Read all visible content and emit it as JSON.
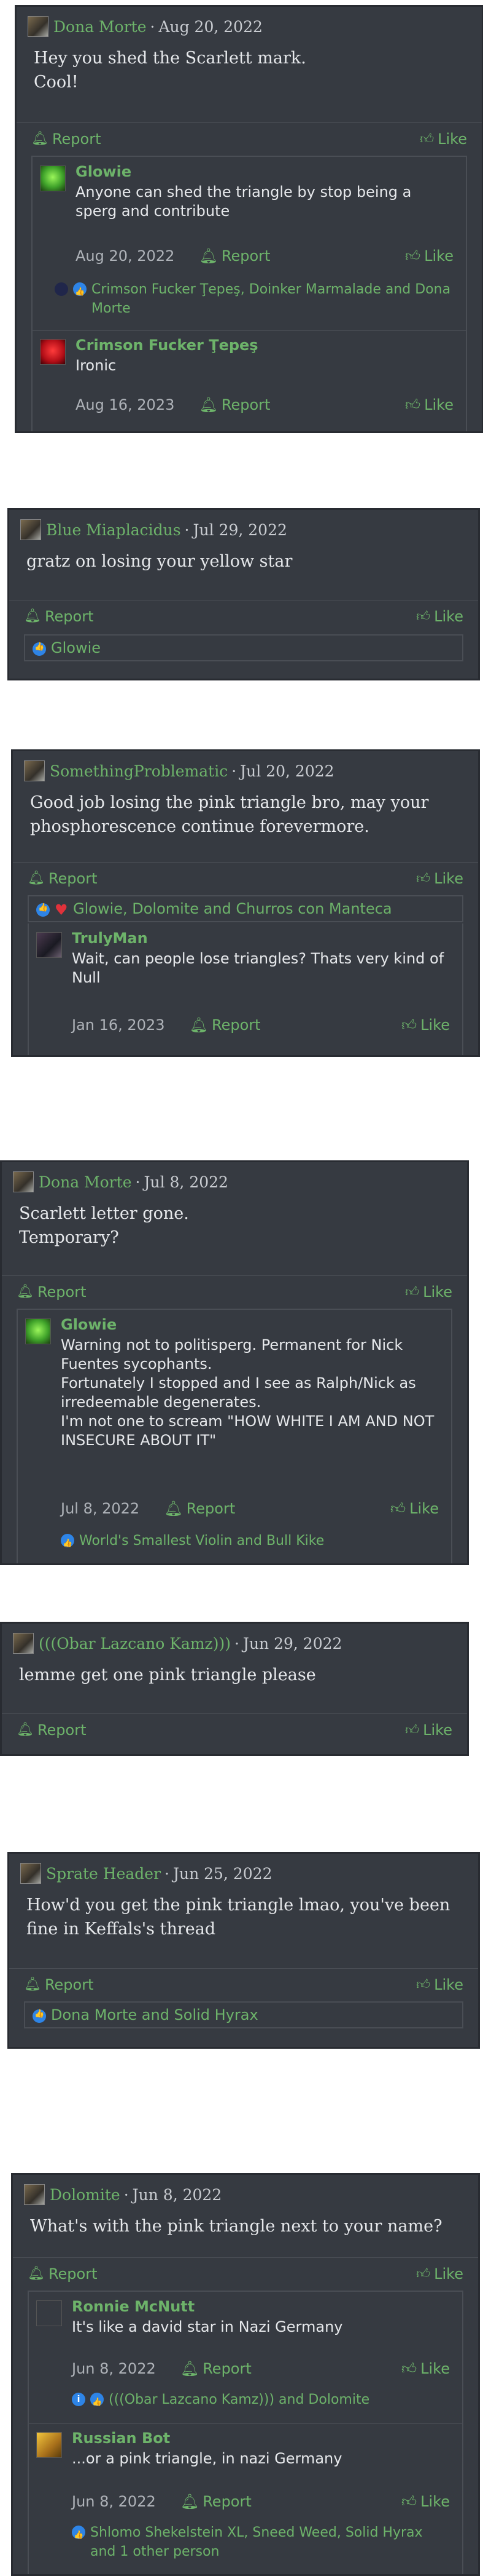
{
  "ui": {
    "report_label": "Report",
    "like_label": "Like",
    "separator": "·"
  },
  "posts": [
    {
      "author": "Dona Morte",
      "date": "Aug 20, 2022",
      "text": "Hey you shed the Scarlett mark.\nCool!",
      "replies": [
        {
          "author": "Glowie",
          "text": "Anyone can shed the triangle by stop being a sperg and contribute",
          "date": "Aug 20, 2022",
          "reactions": "Crimson Fucker Ţepeş, Doinker Marmalade and Dona Morte"
        },
        {
          "author": "Crimson Fucker Ţepeş",
          "text": "Ironic",
          "date": "Aug 16, 2023"
        }
      ]
    },
    {
      "author": "Blue Miaplacidus",
      "date": "Jul 29, 2022",
      "text": "gratz on losing your yellow star",
      "reactions": "Glowie"
    },
    {
      "author": "SomethingProblematic",
      "date": "Jul 20, 2022",
      "text": "Good job losing the pink triangle bro, may your phosphorescence continue forevermore.",
      "reactions": "Glowie, Dolomite and Churros con Manteca",
      "replies": [
        {
          "author": "TrulyMan",
          "text": "Wait, can people lose triangles? Thats very kind of Null",
          "date": "Jan 16, 2023"
        }
      ]
    },
    {
      "author": "Dona Morte",
      "date": "Jul 8, 2022",
      "text": "Scarlett letter gone.\nTemporary?",
      "replies": [
        {
          "author": "Glowie",
          "text": "Warning not to politisperg. Permanent for Nick Fuentes sycophants.\nFortunately I stopped and I see as Ralph/Nick as irredeemable degenerates.\nI'm not one to scream \"HOW WHITE I AM AND NOT INSECURE ABOUT IT\"",
          "date": "Jul 8, 2022",
          "reactions": "World's Smallest Violin and Bull Kike"
        }
      ]
    },
    {
      "author": "(((Obar Lazcano Kamz)))",
      "date": "Jun 29, 2022",
      "text": "lemme get one pink triangle please"
    },
    {
      "author": "Sprate Header",
      "date": "Jun 25, 2022",
      "text": "How'd you get the pink triangle lmao, you've been fine in Keffals's thread",
      "reactions": "Dona Morte and Solid Hyrax"
    },
    {
      "author": "Dolomite",
      "date": "Jun 8, 2022",
      "text": "What's with the pink triangle next to your name?",
      "replies": [
        {
          "author": "Ronnie McNutt",
          "text": "It's like a david star in Nazi Germany",
          "date": "Jun 8, 2022",
          "reactions": "(((Obar Lazcano Kamz))) and Dolomite"
        },
        {
          "author": "Russian Bot",
          "text": "...or a pink triangle, in nazi Germany",
          "date": "Jun 8, 2022",
          "reactions": "Shlomo Shekelstein XL, Sneed Weed, Solid Hyrax and 1 other person"
        }
      ]
    }
  ]
}
